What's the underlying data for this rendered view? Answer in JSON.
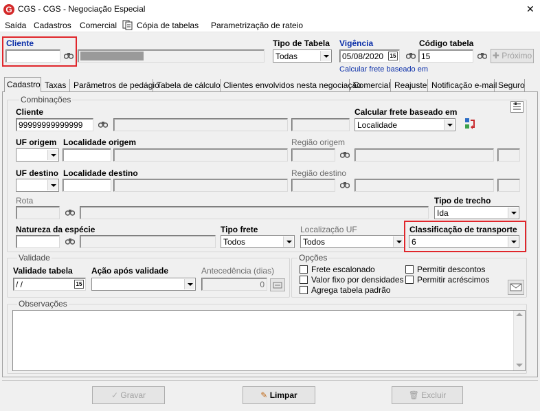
{
  "window": {
    "title": "CGS - CGS - Negociação Especial",
    "close_symbol": "✕"
  },
  "menu": {
    "saida": "Saída",
    "cadastros": "Cadastros",
    "comercial": "Comercial",
    "copia_tabelas": "Cópia de tabelas",
    "parametrizacao": "Parametrização de rateio"
  },
  "header": {
    "cliente_label": "Cliente",
    "cliente_value": "",
    "tipo_tabela_label": "Tipo de Tabela",
    "tipo_tabela_value": "Todas",
    "vigencia_label": "Vigência",
    "vigencia_value": "05/08/2020",
    "codigo_tabela_label": "Código tabela",
    "codigo_tabela_value": "15",
    "proximo_label": "Próximo",
    "calcular_link": "Calcular frete baseado em",
    "calendar_glyph": "15"
  },
  "tabs": [
    "Cadastro",
    "Taxas",
    "Parâmetros de pedágio",
    "Tabela de cálculo",
    "Clientes envolvidos nesta negociação",
    "Comercial",
    "Reajuste",
    "Notificação e-mail",
    "Seguro"
  ],
  "combinacoes": {
    "group_label": "Combinações",
    "cliente_label": "Cliente",
    "cliente_value": "99999999999999",
    "calcular_label": "Calcular frete baseado em",
    "calcular_value": "Localidade",
    "uf_origem_label": "UF origem",
    "localidade_origem_label": "Localidade origem",
    "regiao_origem_label": "Região origem",
    "uf_destino_label": "UF destino",
    "localidade_destino_label": "Localidade destino",
    "regiao_destino_label": "Região destino",
    "rota_label": "Rota",
    "tipo_trecho_label": "Tipo de trecho",
    "tipo_trecho_value": "Ida",
    "natureza_label": "Natureza da espécie",
    "tipo_frete_label": "Tipo frete",
    "tipo_frete_value": "Todos",
    "localizacao_uf_label": "Localização UF",
    "localizacao_uf_value": "Todos",
    "classificacao_label": "Classificação de transporte",
    "classificacao_value": "6"
  },
  "validade": {
    "group_label": "Validade",
    "validade_tabela_label": "Validade tabela",
    "validade_tabela_value": " /  /",
    "acao_label": "Ação após validade",
    "antecedencia_label": "Antecedência (dias)",
    "antecedencia_value": "0"
  },
  "opcoes": {
    "group_label": "Opções",
    "frete_escalonado": "Frete escalonado",
    "valor_fixo": "Valor fixo por densidades",
    "agrega_tabela": "Agrega tabela padrão",
    "permitir_descontos": "Permitir descontos",
    "permitir_acrescimos": "Permitir acréscimos"
  },
  "observacoes": {
    "group_label": "Observações"
  },
  "buttons": {
    "gravar": "Gravar",
    "limpar": "Limpar",
    "excluir": "Excluir"
  },
  "colors": {
    "highlight": "#e0262b",
    "link_blue": "#0a2ea8",
    "app_icon": "#d42a2a"
  }
}
